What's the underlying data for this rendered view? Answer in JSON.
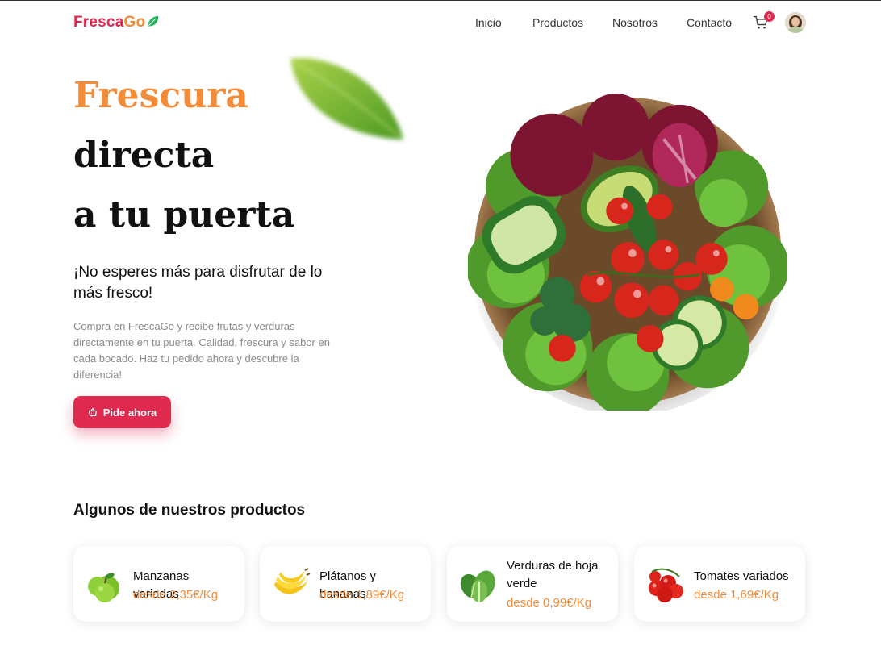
{
  "brand": {
    "part1": "Fresca",
    "part2": "Go",
    "colors": {
      "primary": "#e0294f",
      "accent": "#f28c38"
    }
  },
  "nav": {
    "links": [
      "Inicio",
      "Productos",
      "Nosotros",
      "Contacto"
    ],
    "cart_count": "0",
    "icons": [
      "leaf-icon",
      "cart-icon",
      "avatar"
    ]
  },
  "hero": {
    "line1": "Frescura",
    "line2": "directa",
    "line3": "a tu puerta",
    "subtitle": "¡No esperes más para disfrutar de lo más fresco!",
    "description": "Compra en FrescaGo y recibe frutas y verduras directamente en tu puerta. Calidad, frescura y sabor en cada bocado. Haz tu pedido ahora y descubre la diferencia!",
    "cta_label": "Pide ahora",
    "cta_icon": "basket-icon"
  },
  "products": {
    "title": "Algunos de nuestros productos",
    "items": [
      {
        "name": "Manzanas variadas",
        "price": "desde 2,35€/Kg",
        "icon": "apple-icon"
      },
      {
        "name": "Plátanos y bananas",
        "price": "desde 1,89€/Kg",
        "icon": "banana-icon"
      },
      {
        "name": "Verduras de hoja verde",
        "price": "desde 0,99€/Kg",
        "icon": "leafy-greens-icon"
      },
      {
        "name": "Tomates variados",
        "price": "desde 1,69€/Kg",
        "icon": "tomato-icon"
      }
    ]
  }
}
